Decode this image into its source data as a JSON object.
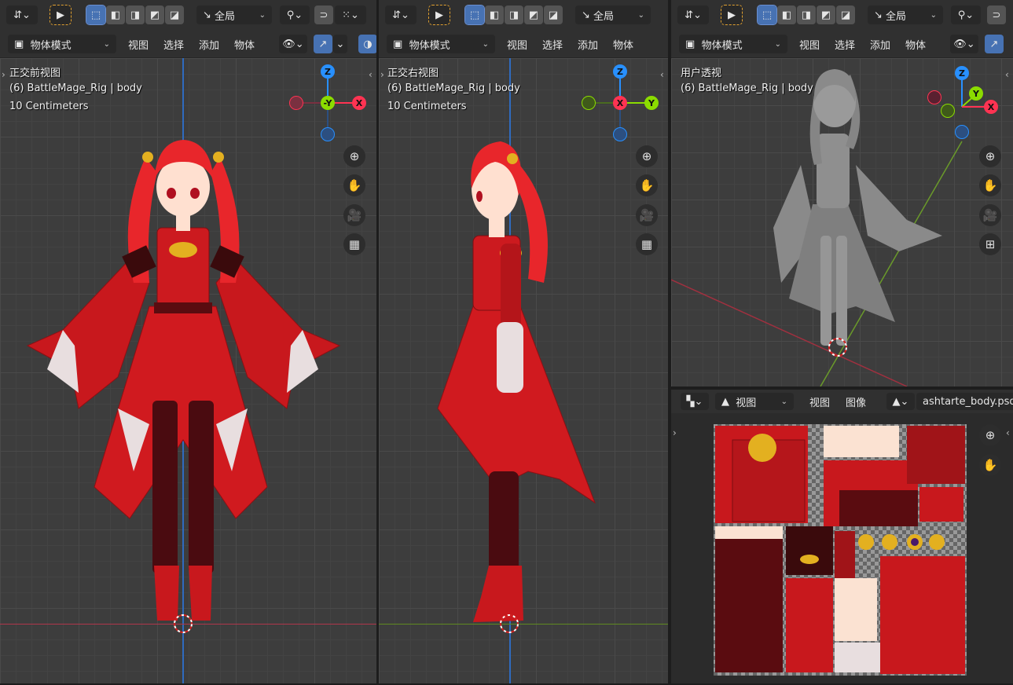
{
  "toolbar": {
    "transform_orientation": "全局",
    "mode": "物体模式",
    "menus": [
      "视图",
      "选择",
      "添加",
      "物体"
    ]
  },
  "viewports": [
    {
      "view_name": "正交前视图",
      "object_info": "(6) BattleMage_Rig | body",
      "scale": "10 Centimeters",
      "gizmo": {
        "top": "Z",
        "center": "-Y",
        "right": "X"
      }
    },
    {
      "view_name": "正交右视图",
      "object_info": "(6) BattleMage_Rig | body",
      "scale": "10 Centimeters",
      "gizmo": {
        "top": "Z",
        "center": "X",
        "right": "Y"
      }
    },
    {
      "view_name": "用户透视",
      "object_info": "(6) BattleMage_Rig | body",
      "gizmo": {
        "top": "Z",
        "mid": "Y",
        "right": "X"
      }
    }
  ],
  "image_editor": {
    "menus": [
      "视图",
      "视图",
      "图像"
    ],
    "image_name": "ashtarte_body.psd"
  },
  "colors": {
    "axis_x": "#ff3352",
    "axis_y": "#8bdc00",
    "axis_z": "#2890ff",
    "header_bg": "#303030",
    "viewport_bg": "#3d3d3d",
    "accent_blue": "#4772b3"
  }
}
